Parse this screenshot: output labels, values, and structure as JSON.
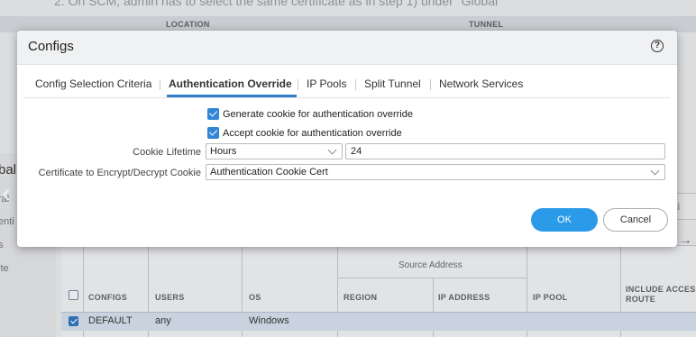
{
  "background": {
    "top_text": "2. On SCM, admin has to select the same certificate as in step 1) under \"Global",
    "header_cols": {
      "location": "LOCATION",
      "tunnel": "TUNNEL"
    },
    "left_panel": {
      "title": "bal",
      "items": [
        "ral",
        "enti",
        "s",
        "ite"
      ]
    },
    "right_button_text": "cati",
    "right_arrow": "→",
    "table": {
      "group_header": "Source Address",
      "columns": [
        "CONFIGS",
        "USERS",
        "OS",
        "REGION",
        "IP ADDRESS",
        "IP POOL",
        "INCLUDE ACCESS ROUTE"
      ],
      "rows": [
        {
          "config": "DEFAULT",
          "users": "any",
          "os": "Windows",
          "checked": true
        }
      ]
    }
  },
  "modal": {
    "title": "Configs",
    "help_icon": "?",
    "tabs": [
      {
        "label": "Config Selection Criteria",
        "active": false
      },
      {
        "label": "Authentication Override",
        "active": true
      },
      {
        "label": "IP Pools",
        "active": false
      },
      {
        "label": "Split Tunnel",
        "active": false
      },
      {
        "label": "Network Services",
        "active": false
      }
    ],
    "generate_cookie": {
      "label": "Generate cookie for authentication override",
      "checked": true
    },
    "accept_cookie": {
      "label": "Accept cookie for authentication override",
      "checked": true
    },
    "cookie_lifetime": {
      "label": "Cookie Lifetime",
      "unit": "Hours",
      "value": "24"
    },
    "certificate": {
      "label": "Certificate to Encrypt/Decrypt Cookie",
      "value": "Authentication Cookie Cert"
    },
    "ok_label": "OK",
    "cancel_label": "Cancel"
  },
  "colors": {
    "accent": "#2b9ae8",
    "tab_underline": "#2f7fc9",
    "checkbox": "#2f86d4"
  }
}
